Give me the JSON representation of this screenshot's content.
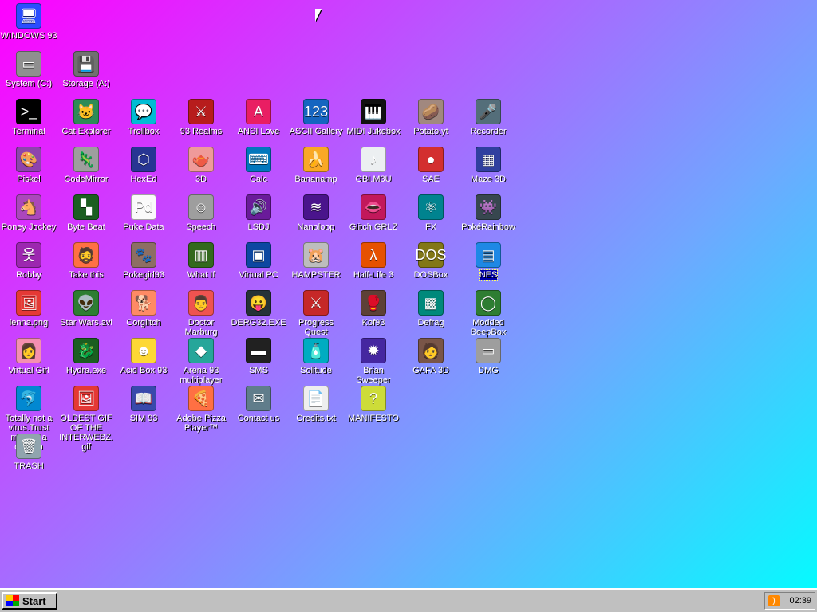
{
  "desktop": {
    "icons": [
      {
        "label": "WINDOWS 93",
        "glyph": "🖥",
        "color": "#2a4dff"
      },
      {
        "label": "System (C:)",
        "glyph": "▭",
        "color": "#8f8f8f"
      },
      {
        "label": "Storage (A:)",
        "glyph": "💾",
        "color": "#707070"
      },
      {
        "label": "Terminal",
        "glyph": ">_",
        "color": "#000000"
      },
      {
        "label": "Cat Explorer",
        "glyph": "🐱",
        "color": "#2e8b57"
      },
      {
        "label": "Trollbox",
        "glyph": "💬",
        "color": "#00bcd4"
      },
      {
        "label": "93 Realms",
        "glyph": "⚔",
        "color": "#b71c1c"
      },
      {
        "label": "ANSI Love",
        "glyph": "A",
        "color": "#e91e63"
      },
      {
        "label": "ASCII Gallery",
        "glyph": "123",
        "color": "#1565c0"
      },
      {
        "label": "MIDI Jukebox",
        "glyph": "🎹",
        "color": "#111111"
      },
      {
        "label": "Potato.yt",
        "glyph": "🥔",
        "color": "#a1887f"
      },
      {
        "label": "Recorder",
        "glyph": "🎤",
        "color": "#546e7a"
      },
      {
        "label": "Piskel",
        "glyph": "🎨",
        "color": "#8e44ad"
      },
      {
        "label": "CodeMirror",
        "glyph": "🦎",
        "color": "#9e9e9e"
      },
      {
        "label": "HexEd",
        "glyph": "⬡",
        "color": "#283593"
      },
      {
        "label": "3D",
        "glyph": "🫖",
        "color": "#ef9a9a"
      },
      {
        "label": "Calc",
        "glyph": "⌨",
        "color": "#0277bd"
      },
      {
        "label": "Bananamp",
        "glyph": "🍌",
        "color": "#f9a825"
      },
      {
        "label": "GBI.M3U",
        "glyph": "♪",
        "color": "#eceff1"
      },
      {
        "label": "SAE",
        "glyph": "●",
        "color": "#d32f2f"
      },
      {
        "label": "Maze 3D",
        "glyph": "▦",
        "color": "#303f9f"
      },
      {
        "label": "Poney Jockey",
        "glyph": "🐴",
        "color": "#ab47bc"
      },
      {
        "label": "Byte Beat",
        "glyph": "▚",
        "color": "#1b5e20"
      },
      {
        "label": "Puke Data",
        "glyph": "Pd",
        "color": "#fafafa"
      },
      {
        "label": "Speech",
        "glyph": "☺",
        "color": "#9e9e9e"
      },
      {
        "label": "LSDJ",
        "glyph": "🔊",
        "color": "#6a1b9a"
      },
      {
        "label": "Nanoloop",
        "glyph": "≋",
        "color": "#4a148c"
      },
      {
        "label": "Glitch GRLZ",
        "glyph": "👄",
        "color": "#c2185b"
      },
      {
        "label": "FX",
        "glyph": "⚛",
        "color": "#00838f"
      },
      {
        "label": "PokéRainbow",
        "glyph": "👾",
        "color": "#37474f"
      },
      {
        "label": "Robby",
        "glyph": "웃",
        "color": "#9c27b0"
      },
      {
        "label": "Take this",
        "glyph": "🧔",
        "color": "#ff7043"
      },
      {
        "label": "Pokegirl93",
        "glyph": "🐾",
        "color": "#8d6e63"
      },
      {
        "label": "What If",
        "glyph": "▥",
        "color": "#33691e"
      },
      {
        "label": "Virtual PC",
        "glyph": "▣",
        "color": "#0d47a1"
      },
      {
        "label": "HAMPSTER",
        "glyph": "🐹",
        "color": "#bdbdbd"
      },
      {
        "label": "Half-Life 3",
        "glyph": "λ",
        "color": "#e65100"
      },
      {
        "label": "DOSBox",
        "glyph": "DOS",
        "color": "#827717"
      },
      {
        "label": "NES",
        "glyph": "▤",
        "color": "#1e88e5",
        "selected": true
      },
      {
        "label": "lenna.png",
        "glyph": "🖼",
        "color": "#e53935"
      },
      {
        "label": "Star Wars.avi",
        "glyph": "👽",
        "color": "#2e7d32"
      },
      {
        "label": "Corglitch",
        "glyph": "🐕",
        "color": "#ff8a65"
      },
      {
        "label": "Doctor Marburg",
        "glyph": "👨",
        "color": "#ef5350"
      },
      {
        "label": "DERG32.EXE",
        "glyph": "😛",
        "color": "#263238"
      },
      {
        "label": "Progress Quest",
        "glyph": "⚔",
        "color": "#c62828"
      },
      {
        "label": "Kof93",
        "glyph": "🥊",
        "color": "#5d4037"
      },
      {
        "label": "Defrag",
        "glyph": "▩",
        "color": "#00897b"
      },
      {
        "label": "Modded BeepBox",
        "glyph": "◯",
        "color": "#2e7d32"
      },
      {
        "label": "Virtual Girl",
        "glyph": "👩",
        "color": "#f48fb1"
      },
      {
        "label": "Hydra.exe",
        "glyph": "🐉",
        "color": "#1b5e20"
      },
      {
        "label": "Acid Box 93",
        "glyph": "☻",
        "color": "#fdd835"
      },
      {
        "label": "Arena 93 multiplayer",
        "glyph": "◆",
        "color": "#26a69a"
      },
      {
        "label": "SMS",
        "glyph": "▬",
        "color": "#212121"
      },
      {
        "label": "Solitude",
        "glyph": "🧴",
        "color": "#00acc1"
      },
      {
        "label": "Brian Sweeper",
        "glyph": "✹",
        "color": "#4527a0"
      },
      {
        "label": "GAFA 3D",
        "glyph": "🧑",
        "color": "#795548"
      },
      {
        "label": "DMG",
        "glyph": "▭",
        "color": "#9e9e9e"
      },
      {
        "label": "Totally not a virus.Trust me...im a dolphin",
        "glyph": "🐬",
        "color": "#0288d1"
      },
      {
        "label": "OLDEST GIF OF THE INTERWEBZ.gif",
        "glyph": "🖼",
        "color": "#e53935"
      },
      {
        "label": "SIM 93",
        "glyph": "📖",
        "color": "#3949ab"
      },
      {
        "label": "Adobe Pizza Player™",
        "glyph": "🍕",
        "color": "#ff7043"
      },
      {
        "label": "Contact us",
        "glyph": "✉",
        "color": "#607d8b"
      },
      {
        "label": "Credits.txt",
        "glyph": "📄",
        "color": "#eeeeee"
      },
      {
        "label": "MANIFESTO",
        "glyph": "?",
        "color": "#cddc39"
      },
      {
        "label": "TRASH",
        "glyph": "🗑",
        "color": "#90a4ae"
      }
    ]
  },
  "taskbar": {
    "start_label": "Start",
    "clock": "02:39",
    "tray_icon": "rss-icon"
  }
}
